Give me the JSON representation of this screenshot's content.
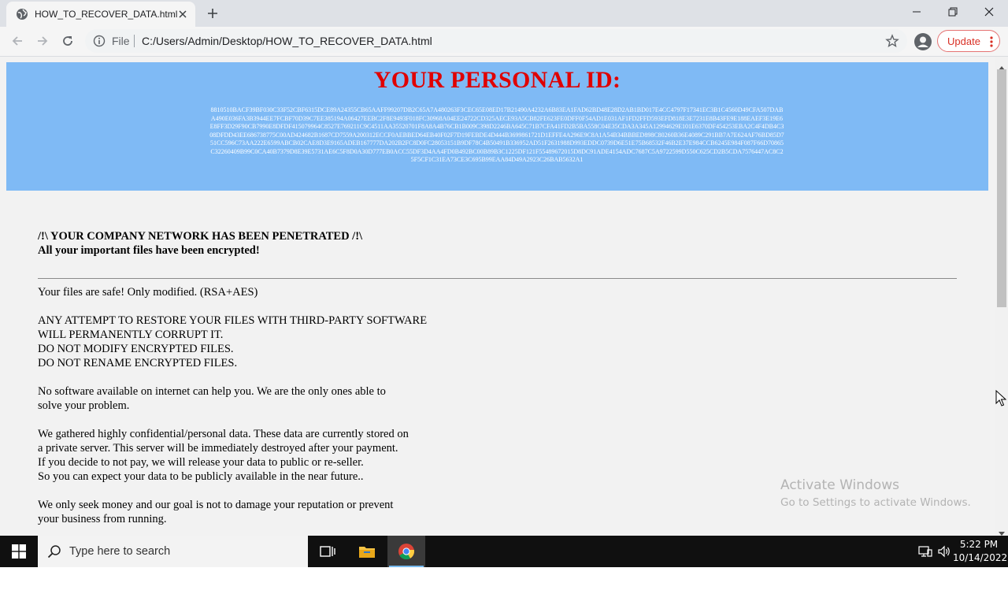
{
  "browser": {
    "tab_title": "HOW_TO_RECOVER_DATA.html",
    "scheme_label": "File",
    "url": "C:/Users/Admin/Desktop/HOW_TO_RECOVER_DATA.html",
    "update_label": "Update"
  },
  "page": {
    "banner_title": "YOUR PERSONAL ID:",
    "personal_id": "8810510BACF39BF030C33F52CBF6315DCE89A24355CB65AAFF99207DB2C65A7A480263F3CEC65E08ED17B21490A4232A6B83EA1FAD62BD48E28D2AB1BD017E4CC4797F17341EC3B1C4560D49CFA507DABA490E036FA3B3944EE7FCBF70D39C7EE385194A06427EEBC2F8E9493F018FC30968A04EE24722CD325AECE93A5CB82FE623FE0DFF0F54AD1E031AF1FD2FFD593EFD818E3E7231E8B43FE9E188EAEF3E19E6E8FF3D29F90CB7990E8DFDF415079964C8527E769211C9C4511AA35520701F8A8A4B76CB1B009C398D2246BA645C71B7CFA41FD2B5BA558C04E35CDA3A345A12994629E101E6370DF454253EBA2C4F4DB4C308DFDD43EE686738775C00AD424682B1687CD7559A200312ECCF0AEBBED64EB40F02F7D19FEBDE4D444B3699861721D1EFFE4A296E9C8A1A54B34BBBED898C80260B36E4089C291BB7A7E624AF76BD85D751CC596C73AA222E6599ABCB02CAE8D3E9165ADEB167777DA202B2FC8D0FC28053151B9DF78C4B50491B336952AD51F2631988D993EDDC0739D6E51E75B68532F46B2E37E984CCB6245E984F087F66D70865C32260409B99C0CA40B7379D8E39E5731AE6C5F8D0A30D777EB0ACC55DF3D4AA4FD0B492BC00B89B3C1225DF121F55489672015D8DC91ADE4154ADC7687C5A9722599D550C625CD2B5CDA7576447AC8C25F5CF1C31EA73CE3C695B99EAA84D49A2923C26BAB5632A1",
    "headline_1": "/!\\ YOUR COMPANY NETWORK HAS BEEN PENETRATED /!\\",
    "headline_2": "All your important files have been encrypted!",
    "p1": "Your files are safe! Only modified. (RSA+AES)",
    "p2_l1": "ANY ATTEMPT TO RESTORE YOUR FILES WITH THIRD-PARTY SOFTWARE",
    "p2_l2": "WILL PERMANENTLY CORRUPT IT.",
    "p2_l3": "DO NOT MODIFY ENCRYPTED FILES.",
    "p2_l4": "DO NOT RENAME ENCRYPTED FILES.",
    "p3_l1": "No software available on internet can help you. We are the only ones able to",
    "p3_l2": "solve your problem.",
    "p4_l1": "We gathered highly confidential/personal data. These data are currently stored on",
    "p4_l2": "a private server. This server will be immediately destroyed after your payment.",
    "p4_l3": "If you decide to not pay, we will release your data to public or re-seller.",
    "p4_l4": "So you can expect your data to be publicly available in the near future..",
    "p5_l1": "We only seek money and our goal is not to damage your reputation or prevent",
    "p5_l2": "your business from running."
  },
  "watermark": {
    "line1": "Activate Windows",
    "line2": "Go to Settings to activate Windows."
  },
  "taskbar": {
    "search_placeholder": "Type here to search",
    "time": "5:22 PM",
    "date": "10/14/2022"
  },
  "colors": {
    "banner_bg": "#7fbaf5",
    "banner_title": "#e00000",
    "update_red": "#d93025",
    "taskbar": "#101010"
  }
}
